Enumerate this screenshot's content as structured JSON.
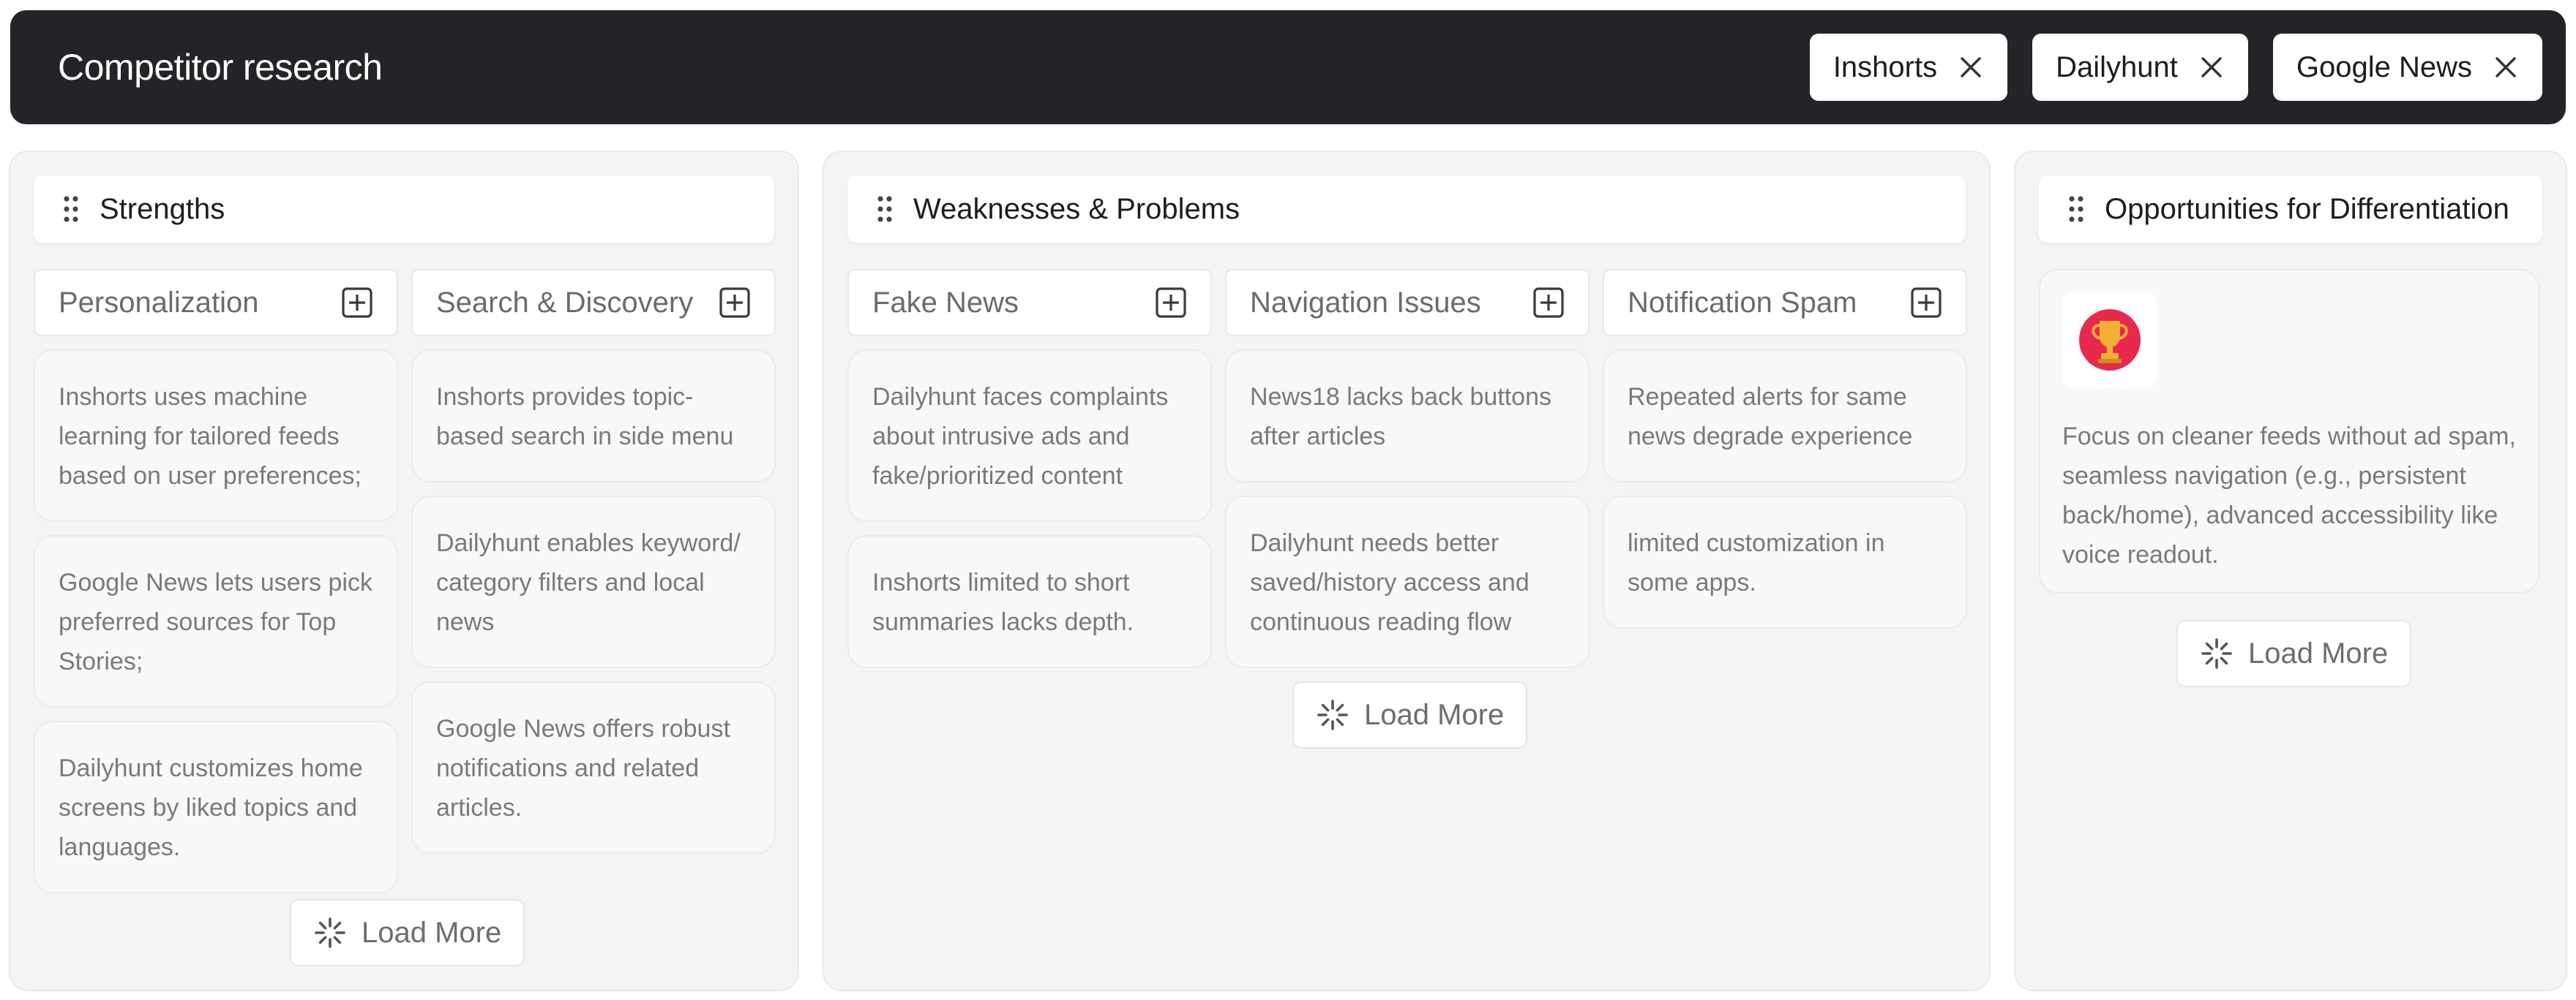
{
  "header": {
    "title": "Competitor research",
    "chips": [
      {
        "label": "Inshorts"
      },
      {
        "label": "Dailyhunt"
      },
      {
        "label": "Google News"
      }
    ]
  },
  "columns": {
    "strengths": {
      "title": "Strengths",
      "groups": [
        {
          "title": "Personalization",
          "cards": [
            "Inshorts uses machine learning for tailored feeds based on user preferences;",
            "Google News lets users pick preferred sources for Top Stories;",
            "Dailyhunt customizes home screens by liked topics and languages."
          ]
        },
        {
          "title": "Search & Discovery",
          "cards": [
            "Inshorts provides topic-based search in side menu",
            "Dailyhunt enables keyword/ category filters and local news",
            "Google News offers robust notifications and related articles."
          ]
        }
      ],
      "load_more": "Load More"
    },
    "weaknesses": {
      "title": "Weaknesses & Problems",
      "groups": [
        {
          "title": "Fake News",
          "cards": [
            "Dailyhunt faces complaints about intrusive ads and fake/prioritized content",
            "Inshorts limited to short summaries lacks depth."
          ]
        },
        {
          "title": "Navigation Issues",
          "cards": [
            "News18 lacks back buttons after articles",
            "Dailyhunt needs better saved/history access and continuous reading flow"
          ]
        },
        {
          "title": "Notification Spam",
          "cards": [
            "Repeated alerts for same news degrade experience",
            "limited customization in some apps."
          ]
        }
      ],
      "load_more": "Load More"
    },
    "opportunities": {
      "title": "Opportunities for Differentiation",
      "card_text": "Focus on cleaner feeds without ad spam, seamless navigation (e.g., persistent back/home), advanced accessibility like voice readout.",
      "card_icon": "trophy-icon",
      "load_more": "Load More"
    }
  },
  "colors": {
    "header_bg": "#232427",
    "column_bg": "#f4f4f4",
    "card_bg": "#f8f8f8",
    "trophy_red": "#e8294e",
    "trophy_gold": "#f2b134"
  }
}
